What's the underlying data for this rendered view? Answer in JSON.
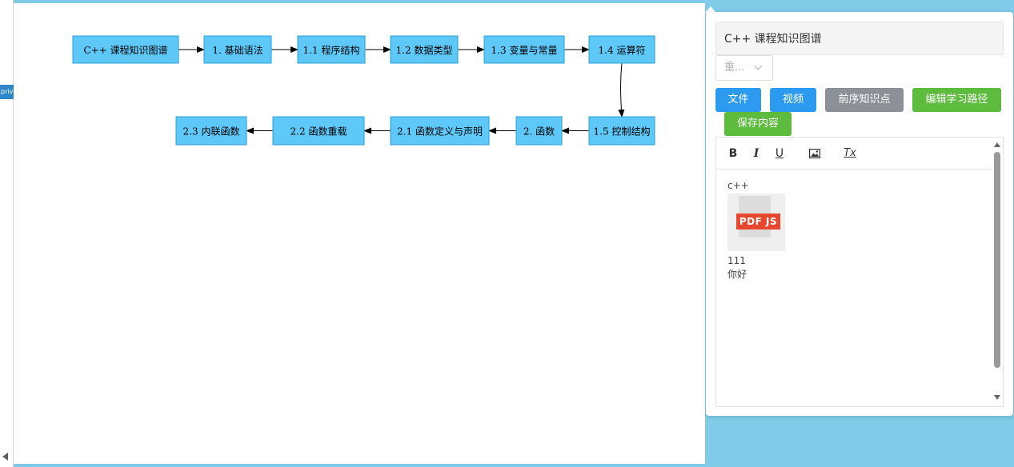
{
  "sidebar": {
    "private_tag": "private"
  },
  "graph": {
    "nodes": [
      {
        "id": "root",
        "label": "C++ 课程知识图谱"
      },
      {
        "id": "n1",
        "label": "1. 基础语法"
      },
      {
        "id": "n1_1",
        "label": "1.1 程序结构"
      },
      {
        "id": "n1_2",
        "label": "1.2 数据类型"
      },
      {
        "id": "n1_3",
        "label": "1.3 变量与常量"
      },
      {
        "id": "n1_4",
        "label": "1.4 运算符"
      },
      {
        "id": "n1_5",
        "label": "1.5 控制结构"
      },
      {
        "id": "n2",
        "label": "2. 函数"
      },
      {
        "id": "n2_1",
        "label": "2.1 函数定义与声明"
      },
      {
        "id": "n2_2",
        "label": "2.2 函数重载"
      },
      {
        "id": "n2_3",
        "label": "2.3 内联函数"
      }
    ],
    "edges": [
      [
        "root",
        "n1"
      ],
      [
        "n1",
        "n1_1"
      ],
      [
        "n1_1",
        "n1_2"
      ],
      [
        "n1_2",
        "n1_3"
      ],
      [
        "n1_3",
        "n1_4"
      ],
      [
        "n1_4",
        "n1_5"
      ],
      [
        "n1_5",
        "n2"
      ],
      [
        "n2",
        "n2_1"
      ],
      [
        "n2_1",
        "n2_2"
      ],
      [
        "n2_2",
        "n2_3"
      ]
    ]
  },
  "panel": {
    "title_value": "C++ 课程知识图谱",
    "level_select": "重...",
    "buttons": {
      "file": "文件",
      "video": "视频",
      "prerequisite": "前序知识点",
      "edit_path": "编辑学习路径",
      "save": "保存内容"
    },
    "toolbar": {
      "bold": "B",
      "italic": "I",
      "underline": "U",
      "clear_format": "Tx"
    },
    "content": {
      "line1": "c++",
      "pdf_label": "PDF JS",
      "line2": "111",
      "line3": "你好"
    }
  },
  "colors": {
    "node_fill": "#5ec8f8",
    "btn_blue": "#2c9aef",
    "btn_gray": "#8c9197",
    "btn_green": "#5dbb3d",
    "background": "#7fcbe8"
  }
}
